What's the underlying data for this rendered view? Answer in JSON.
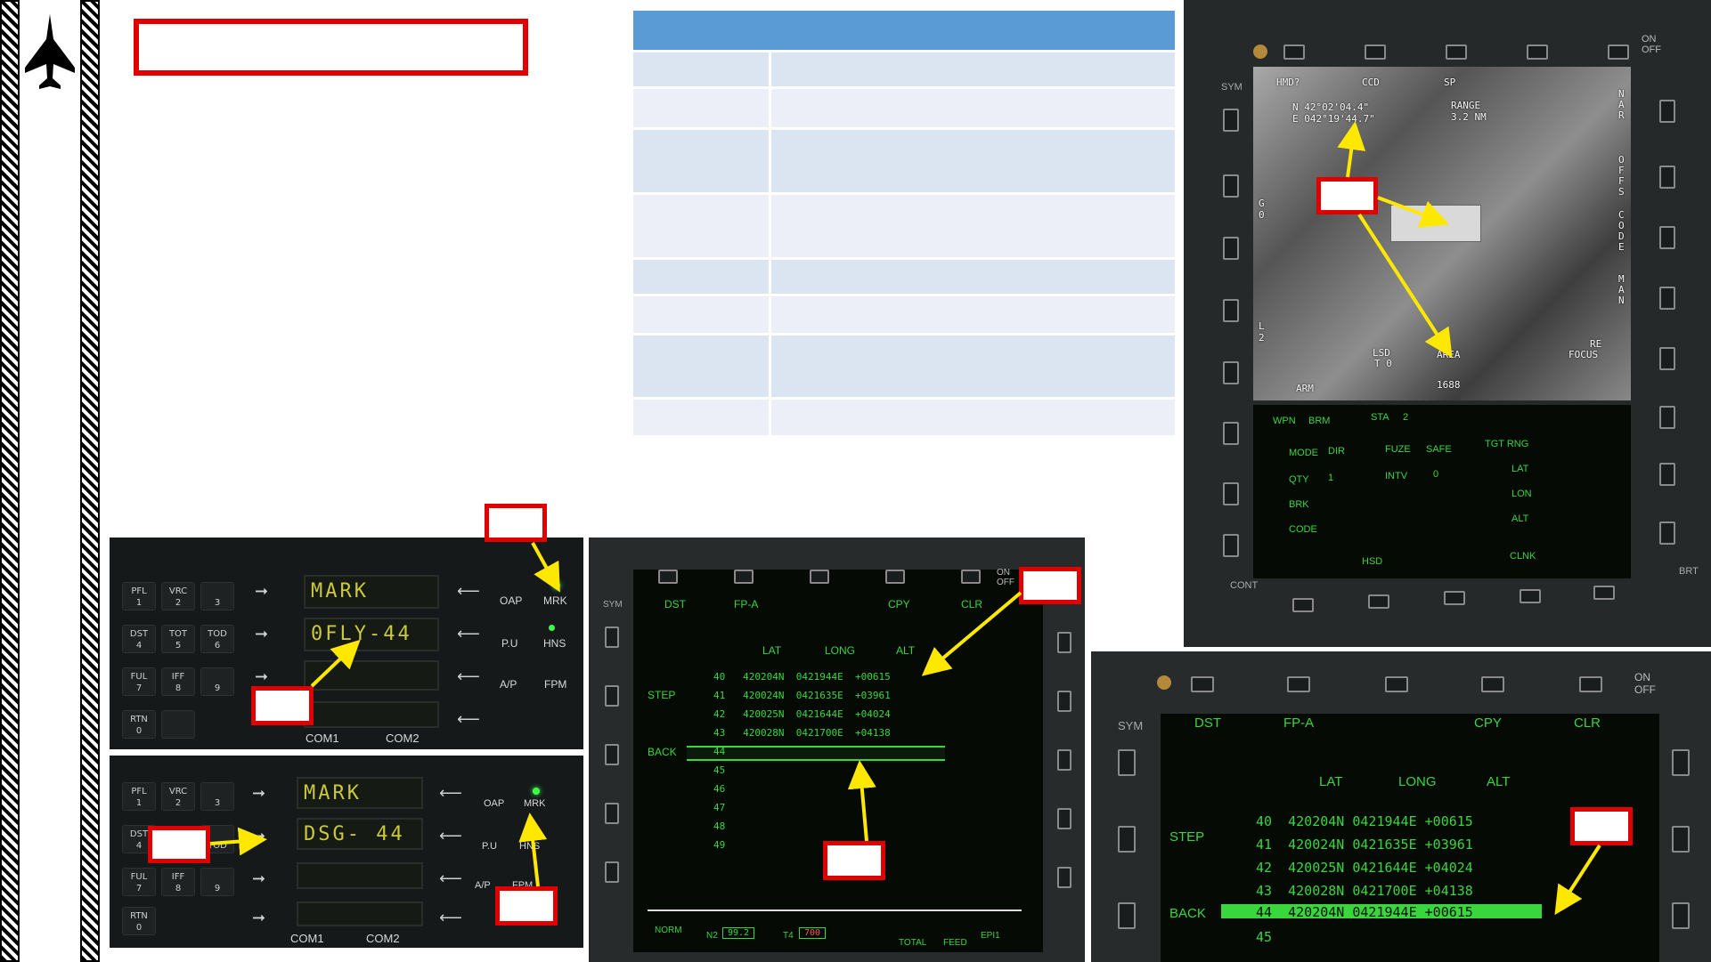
{
  "colors": {
    "accent": "#5b9bd5",
    "table_light": "#dbe4f1",
    "table_alt": "#eceff7",
    "callout": "#e00000",
    "arrow": "#ffe800",
    "mfd_green": "#39d63d"
  },
  "ufc_top": {
    "display_lines": [
      "MARK",
      "0FLY-44"
    ],
    "left_keys": [
      [
        "PFL",
        "1"
      ],
      [
        "VRC",
        "2"
      ],
      [
        "",
        "3"
      ],
      [
        "DST",
        "4"
      ],
      [
        "TOT",
        "5"
      ],
      [
        "TOD",
        "6"
      ],
      [
        "FUL",
        "7"
      ],
      [
        "IFF",
        "8"
      ],
      [
        "",
        "9"
      ],
      [
        "RTN",
        "0"
      ]
    ],
    "right_labels": [
      "OAP",
      "MRK",
      "P.U",
      "HNS",
      "A/P",
      "FPM"
    ],
    "bottom_labels": [
      "COM1",
      "COM2"
    ]
  },
  "ufc_bottom": {
    "display_lines": [
      "MARK",
      "DSG- 44"
    ],
    "left_keys": [
      [
        "PFL",
        "1"
      ],
      [
        "VRC",
        "2"
      ],
      [
        "",
        "3"
      ],
      [
        "DST",
        "4"
      ],
      [
        "",
        "TOD"
      ],
      [
        "FUL",
        "7"
      ],
      [
        "IFF",
        "8"
      ],
      [
        "",
        "9"
      ],
      [
        "RTN",
        "0"
      ]
    ],
    "right_labels": [
      "OAP",
      "MRK",
      "P.U",
      "HNS",
      "A/P",
      "FPM"
    ],
    "bottom_labels": [
      "COM1",
      "COM2"
    ]
  },
  "mfd_center": {
    "top_labels": [
      "DST",
      "FP-A",
      "CPY",
      "CLR"
    ],
    "side_labels": [
      "SYM",
      "STEP",
      "BACK"
    ],
    "on_off": "ON OFF",
    "columns": [
      "LAT",
      "LONG",
      "ALT"
    ],
    "rows": [
      {
        "n": "40",
        "lat": "420204N",
        "long": "0421944E",
        "alt": "+00615"
      },
      {
        "n": "41",
        "lat": "420024N",
        "long": "0421635E",
        "alt": "+03961"
      },
      {
        "n": "42",
        "lat": "420025N",
        "long": "0421644E",
        "alt": "+04024"
      },
      {
        "n": "43",
        "lat": "420028N",
        "long": "0421700E",
        "alt": "+04138"
      },
      {
        "n": "44"
      },
      {
        "n": "45"
      },
      {
        "n": "46"
      },
      {
        "n": "47"
      },
      {
        "n": "48"
      },
      {
        "n": "49"
      }
    ],
    "bottom": {
      "norm": "NORM",
      "n2_label": "N2",
      "n2": "99.2",
      "t4_label": "T4",
      "t4": "700",
      "total": "TOTAL",
      "feed": "FEED",
      "epi": "EPI1"
    }
  },
  "mfd_right_bottom": {
    "top_labels": [
      "DST",
      "FP-A",
      "CPY",
      "CLR"
    ],
    "side_labels": [
      "SYM",
      "STEP",
      "BACK"
    ],
    "on_off": "ON OFF",
    "columns": [
      "LAT",
      "LONG",
      "ALT"
    ],
    "rows": [
      {
        "n": "40",
        "lat": "420204N",
        "long": "0421944E",
        "alt": "+00615"
      },
      {
        "n": "41",
        "lat": "420024N",
        "long": "0421635E",
        "alt": "+03961"
      },
      {
        "n": "42",
        "lat": "420025N",
        "long": "0421644E",
        "alt": "+04024"
      },
      {
        "n": "43",
        "lat": "420028N",
        "long": "0421700E",
        "alt": "+04138"
      },
      {
        "n": "44",
        "lat": "420204N",
        "long": "0421944E",
        "alt": "+00615"
      },
      {
        "n": "45"
      }
    ]
  },
  "mfd_tgp": {
    "top_labels": [
      "HMD?",
      "CCD",
      "SP"
    ],
    "coords": [
      "N  42°02'04.4\"",
      "E 042°19'44.7\""
    ],
    "range": [
      "RANGE",
      "3.2 NM"
    ],
    "left_labels": [
      "SYM",
      "G 0",
      "L 2",
      "CONT"
    ],
    "right_vertical": [
      "N A R",
      "O F F S",
      "C O D E",
      "M A N"
    ],
    "refocus": [
      "RE",
      "FOCUS"
    ],
    "bottom_overlay": [
      "ARM",
      "LSD",
      "T 0",
      "AREA",
      "1688"
    ],
    "wpn": [
      "WPN",
      "BRM",
      "STA",
      "2"
    ],
    "weapon_rows": [
      [
        "MODE",
        "DIR",
        "FUZE",
        "SAFE",
        "TGT RNG"
      ],
      [
        "QTY",
        "1",
        "INTV",
        "0",
        "LAT"
      ],
      [
        "BRK",
        "",
        "",
        "",
        "LON"
      ],
      [
        "CODE",
        "",
        "",
        "",
        "ALT"
      ]
    ],
    "bottom_row": [
      "HSD",
      "CLNK"
    ],
    "brt": "BRT",
    "on_off": "ON OFF"
  }
}
